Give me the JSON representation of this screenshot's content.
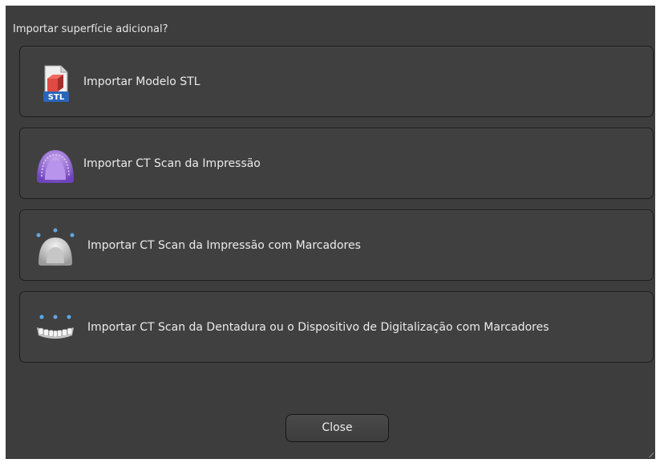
{
  "dialog": {
    "prompt": "Importar superfície adicional?",
    "options": [
      {
        "label": "Importar Modelo STL",
        "icon": "stl-file-icon",
        "icon_text": "STL"
      },
      {
        "label": "Importar CT Scan da Impressão",
        "icon": "impression-tray-icon"
      },
      {
        "label": "Importar CT Scan da Impressão com Marcadores",
        "icon": "impression-markers-icon"
      },
      {
        "label": "Importar CT Scan da Dentadura ou o Dispositivo de Digitalização com Marcadores",
        "icon": "denture-markers-icon"
      }
    ],
    "close_label": "Close"
  },
  "colors": {
    "dialog_background": "#3d3d3d",
    "option_background": "#404040",
    "border": "#1c1c1c",
    "text": "#ebebeb",
    "stl_red": "#d8443d",
    "stl_blue": "#2a66b8",
    "impression_purple": "#8d5fd0",
    "marker_blue": "#5ea8e6"
  }
}
